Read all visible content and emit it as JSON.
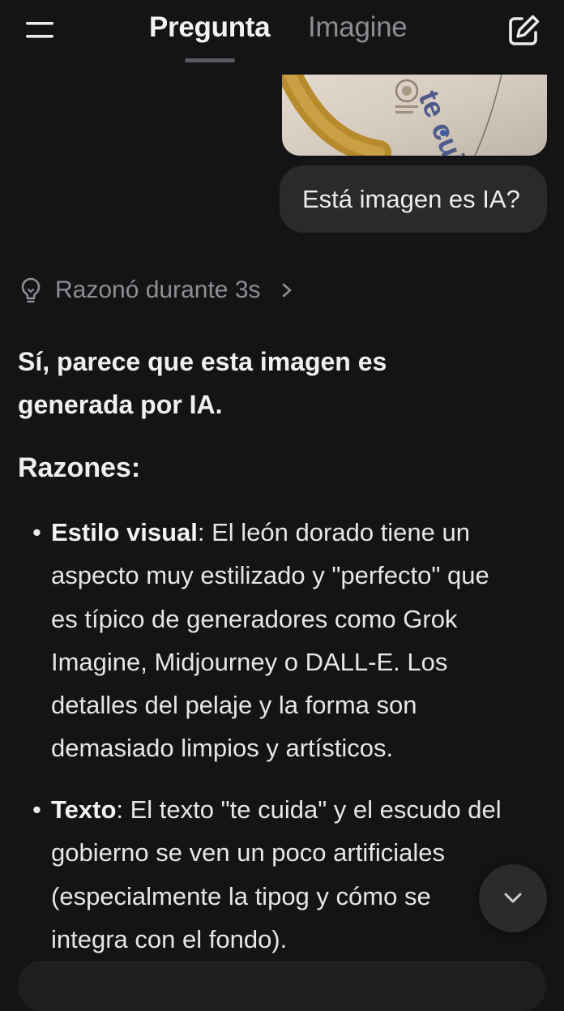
{
  "header": {
    "tabs": [
      {
        "label": "Pregunta",
        "active": true
      },
      {
        "label": "Imagine",
        "active": false
      }
    ],
    "menu_icon": "hamburger-menu-icon",
    "compose_icon": "new-chat-pencil-icon"
  },
  "conversation": {
    "attached_image": {
      "visible_text": "te cuida"
    },
    "user_message": "Está imagen es IA?",
    "reasoning": {
      "label": "Razonó durante 3s",
      "icon": "lightbulb-icon"
    },
    "answer": {
      "heading": "Sí, parece que esta imagen es generada por IA.",
      "section_title": "Razones:",
      "bullets": [
        {
          "title": "Estilo visual",
          "body": ": El león dorado tiene un aspecto muy estilizado y \"perfecto\" que es típico de generadores como Grok Imagine, Midjourney o DALL-E. Los detalles del pelaje y la forma son demasiado limpios y artísticos."
        },
        {
          "title": "Texto",
          "body": ": El texto \"te cuida\" y el escudo del gobierno se ven un poco artificiales (especialmente la tipog y cómo se integra con el fondo)."
        }
      ]
    }
  },
  "colors": {
    "background": "#141416",
    "bubble": "#2a2a2d",
    "muted_text": "#8e8e93",
    "inactive_tab": "#8d8d91"
  }
}
